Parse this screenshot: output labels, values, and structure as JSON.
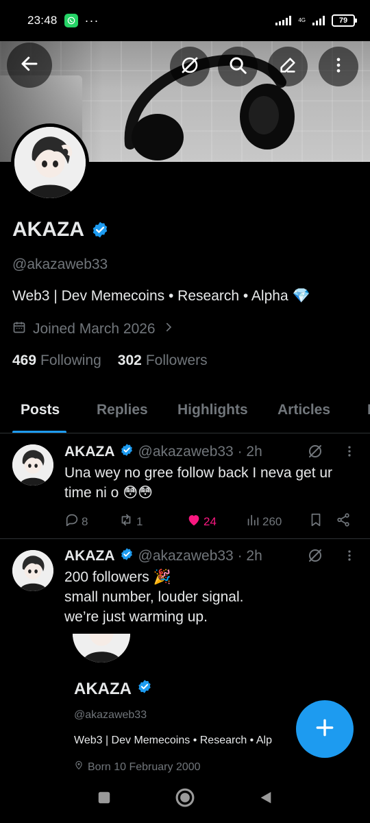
{
  "status_bar": {
    "time": "23:48",
    "dots": "···",
    "battery": "79",
    "network": "4G"
  },
  "header": {
    "back_icon": "arrow-left-icon",
    "grok_icon": "grok-icon",
    "search_icon": "search-icon",
    "edit_icon": "pencil-icon",
    "more_icon": "more-vertical-icon"
  },
  "profile": {
    "name": "AKAZA",
    "handle": "@akazaweb33",
    "bio": "Web3 | Dev  Memecoins • Research • Alpha 💎",
    "joined": "Joined March 2026",
    "following_count": "469",
    "following_label": "Following",
    "followers_count": "302",
    "followers_label": "Followers"
  },
  "tabs": [
    {
      "label": "Posts",
      "active": true
    },
    {
      "label": "Replies",
      "active": false
    },
    {
      "label": "Highlights",
      "active": false
    },
    {
      "label": "Articles",
      "active": false
    },
    {
      "label": "M",
      "active": false
    }
  ],
  "posts": [
    {
      "name": "AKAZA",
      "handle": "@akazaweb33 · 2h",
      "text": "Una wey no gree follow back I neva get ur time ni o 😳😳",
      "replies": "8",
      "reposts": "1",
      "likes": "24",
      "views": "260"
    },
    {
      "name": "AKAZA",
      "handle": "@akazaweb33 · 2h",
      "text_lines": [
        "200 followers 🎉",
        "small number, louder signal.",
        "we’re just warming up."
      ],
      "quote": {
        "name": "AKAZA",
        "handle": "@akazaweb33",
        "bio": "Web3 | Dev  Memecoins • Research • Alp",
        "born": "Born 10 February 2000"
      }
    }
  ],
  "colors": {
    "accent": "#1d9bf0",
    "like": "#f91880",
    "muted": "#71767b",
    "text": "#e7e9ea",
    "bg": "#000000"
  }
}
